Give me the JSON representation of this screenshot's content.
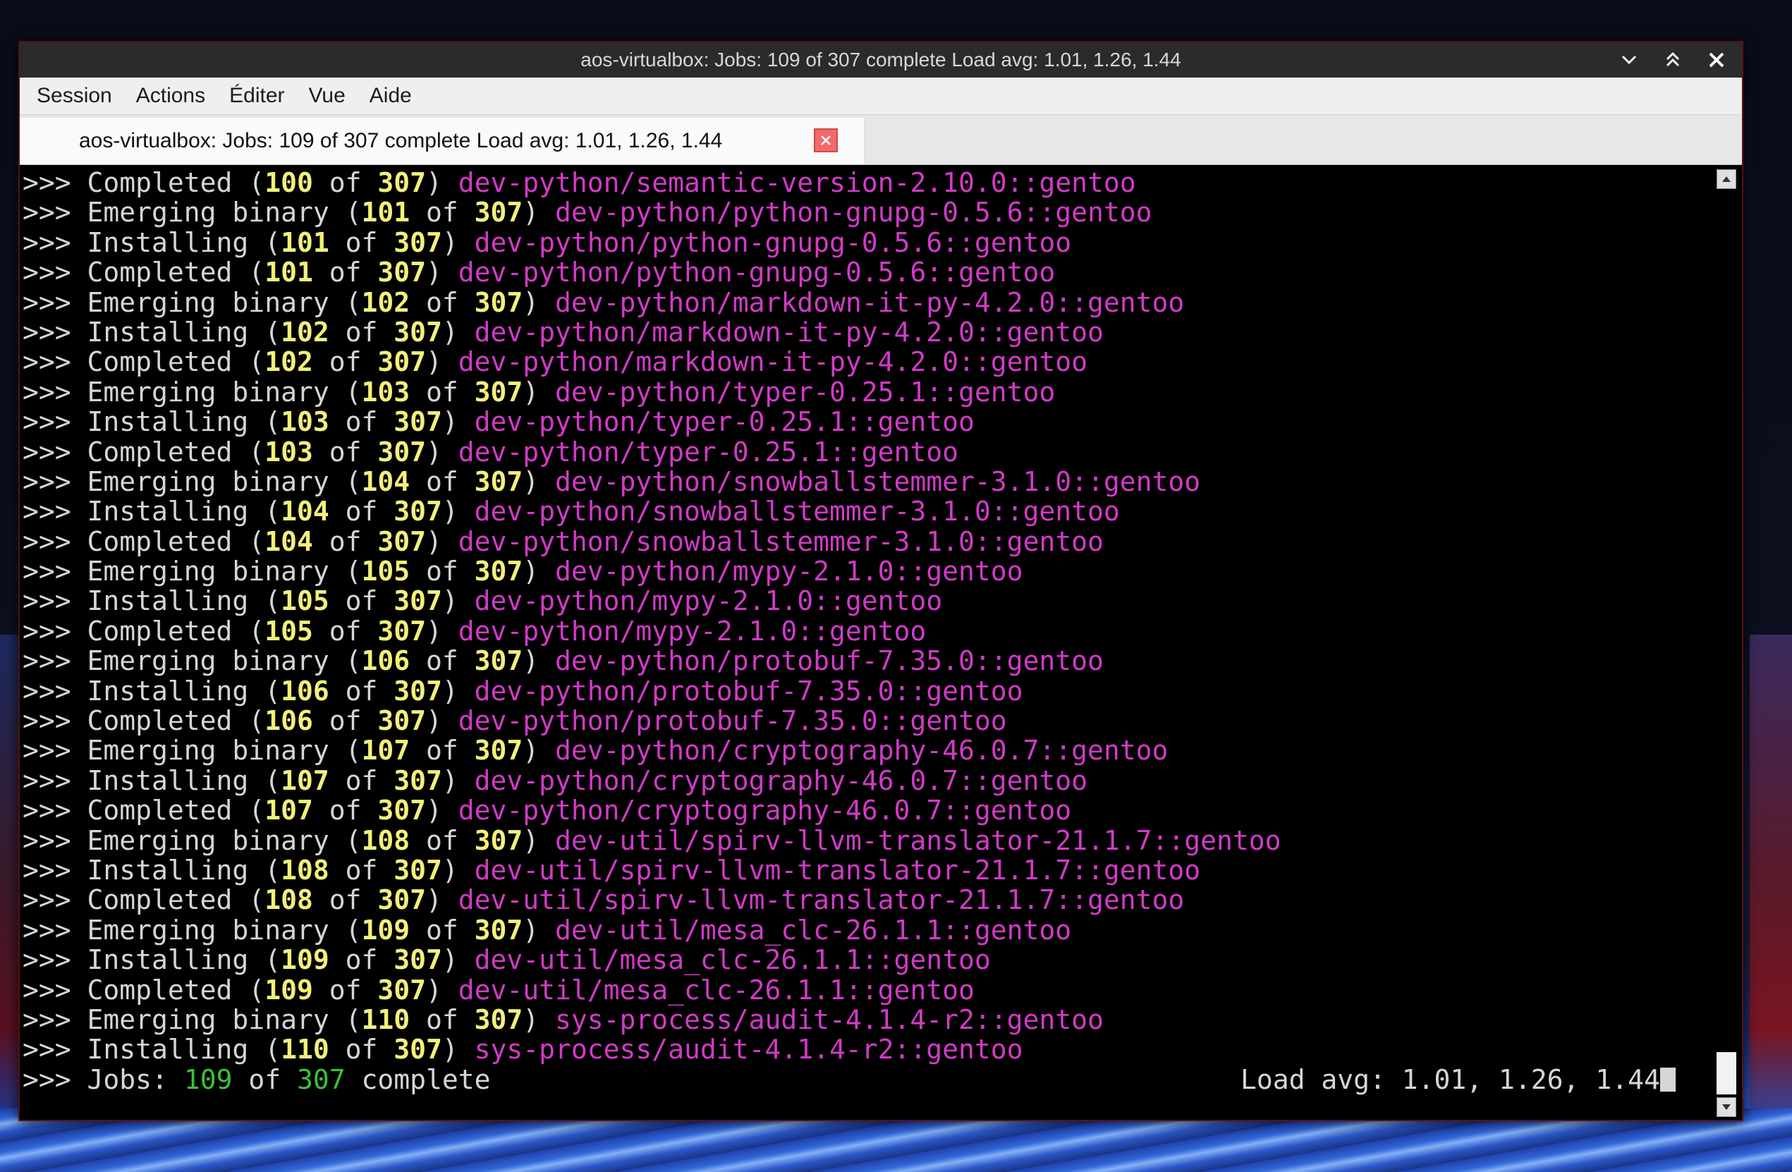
{
  "window": {
    "title": "aos-virtualbox: Jobs: 109 of 307 complete Load avg: 1.01, 1.26, 1.44"
  },
  "menubar": {
    "items": [
      "Session",
      "Actions",
      "Éditer",
      "Vue",
      "Aide"
    ]
  },
  "tab": {
    "label": "aos-virtualbox: Jobs: 109 of 307 complete Load avg: 1.01, 1.26, 1.44"
  },
  "terminal": {
    "prompt": ">>>",
    "lines": [
      {
        "action": "Completed",
        "current": "100",
        "total": "307",
        "package": "dev-python/semantic-version-2.10.0::gentoo"
      },
      {
        "action": "Emerging binary",
        "current": "101",
        "total": "307",
        "package": "dev-python/python-gnupg-0.5.6::gentoo"
      },
      {
        "action": "Installing",
        "current": "101",
        "total": "307",
        "package": "dev-python/python-gnupg-0.5.6::gentoo"
      },
      {
        "action": "Completed",
        "current": "101",
        "total": "307",
        "package": "dev-python/python-gnupg-0.5.6::gentoo"
      },
      {
        "action": "Emerging binary",
        "current": "102",
        "total": "307",
        "package": "dev-python/markdown-it-py-4.2.0::gentoo"
      },
      {
        "action": "Installing",
        "current": "102",
        "total": "307",
        "package": "dev-python/markdown-it-py-4.2.0::gentoo"
      },
      {
        "action": "Completed",
        "current": "102",
        "total": "307",
        "package": "dev-python/markdown-it-py-4.2.0::gentoo"
      },
      {
        "action": "Emerging binary",
        "current": "103",
        "total": "307",
        "package": "dev-python/typer-0.25.1::gentoo"
      },
      {
        "action": "Installing",
        "current": "103",
        "total": "307",
        "package": "dev-python/typer-0.25.1::gentoo"
      },
      {
        "action": "Completed",
        "current": "103",
        "total": "307",
        "package": "dev-python/typer-0.25.1::gentoo"
      },
      {
        "action": "Emerging binary",
        "current": "104",
        "total": "307",
        "package": "dev-python/snowballstemmer-3.1.0::gentoo"
      },
      {
        "action": "Installing",
        "current": "104",
        "total": "307",
        "package": "dev-python/snowballstemmer-3.1.0::gentoo"
      },
      {
        "action": "Completed",
        "current": "104",
        "total": "307",
        "package": "dev-python/snowballstemmer-3.1.0::gentoo"
      },
      {
        "action": "Emerging binary",
        "current": "105",
        "total": "307",
        "package": "dev-python/mypy-2.1.0::gentoo"
      },
      {
        "action": "Installing",
        "current": "105",
        "total": "307",
        "package": "dev-python/mypy-2.1.0::gentoo"
      },
      {
        "action": "Completed",
        "current": "105",
        "total": "307",
        "package": "dev-python/mypy-2.1.0::gentoo"
      },
      {
        "action": "Emerging binary",
        "current": "106",
        "total": "307",
        "package": "dev-python/protobuf-7.35.0::gentoo"
      },
      {
        "action": "Installing",
        "current": "106",
        "total": "307",
        "package": "dev-python/protobuf-7.35.0::gentoo"
      },
      {
        "action": "Completed",
        "current": "106",
        "total": "307",
        "package": "dev-python/protobuf-7.35.0::gentoo"
      },
      {
        "action": "Emerging binary",
        "current": "107",
        "total": "307",
        "package": "dev-python/cryptography-46.0.7::gentoo"
      },
      {
        "action": "Installing",
        "current": "107",
        "total": "307",
        "package": "dev-python/cryptography-46.0.7::gentoo"
      },
      {
        "action": "Completed",
        "current": "107",
        "total": "307",
        "package": "dev-python/cryptography-46.0.7::gentoo"
      },
      {
        "action": "Emerging binary",
        "current": "108",
        "total": "307",
        "package": "dev-util/spirv-llvm-translator-21.1.7::gentoo"
      },
      {
        "action": "Installing",
        "current": "108",
        "total": "307",
        "package": "dev-util/spirv-llvm-translator-21.1.7::gentoo"
      },
      {
        "action": "Completed",
        "current": "108",
        "total": "307",
        "package": "dev-util/spirv-llvm-translator-21.1.7::gentoo"
      },
      {
        "action": "Emerging binary",
        "current": "109",
        "total": "307",
        "package": "dev-util/mesa_clc-26.1.1::gentoo"
      },
      {
        "action": "Installing",
        "current": "109",
        "total": "307",
        "package": "dev-util/mesa_clc-26.1.1::gentoo"
      },
      {
        "action": "Completed",
        "current": "109",
        "total": "307",
        "package": "dev-util/mesa_clc-26.1.1::gentoo"
      },
      {
        "action": "Emerging binary",
        "current": "110",
        "total": "307",
        "package": "sys-process/audit-4.1.4-r2::gentoo"
      },
      {
        "action": "Installing",
        "current": "110",
        "total": "307",
        "package": "sys-process/audit-4.1.4-r2::gentoo"
      }
    ],
    "status": {
      "jobs_label": "Jobs:",
      "jobs_done": "109",
      "of_word": "of",
      "jobs_total": "307",
      "complete_word": "complete",
      "load_avg": "Load avg: 1.01, 1.26, 1.44"
    }
  },
  "colors": {
    "package": "#d23ac7",
    "number": "#f4f07a",
    "status_number": "#3ac23a",
    "text": "#d6d6d6",
    "window_border": "#5a1111",
    "tab_close": "#f36a6a"
  }
}
